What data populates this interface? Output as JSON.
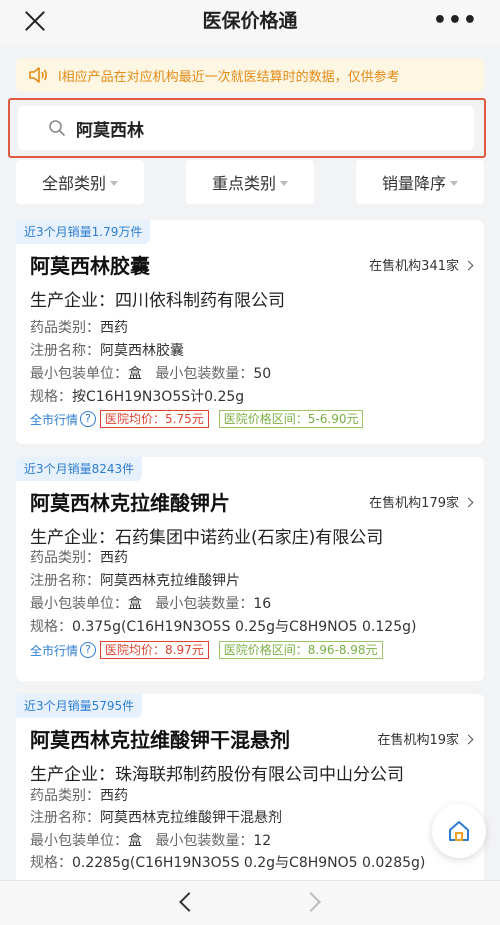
{
  "header": {
    "title": "医保价格通",
    "more": "•••"
  },
  "notice": {
    "text": "l相应产品在对应机构最近一次就医结算时的数据，仅供参考"
  },
  "search": {
    "value": "阿莫西林"
  },
  "filters": [
    {
      "label": "全部类别"
    },
    {
      "label": "重点类别"
    },
    {
      "label": "销量降序"
    }
  ],
  "labels": {
    "maker": "生产企业：",
    "category": "药品类别：",
    "reg_name": "注册名称：",
    "min_unit": "最小包装单位：",
    "min_qty": "最小包装数量：",
    "spec": "规格：",
    "market": "全市行情",
    "help": "?",
    "avg": "医院均价：",
    "range": "医院价格区间："
  },
  "products": [
    {
      "sales": "近3个月销量1.79万件",
      "name": "阿莫西林胶囊",
      "institutions": "在售机构341家",
      "maker": "四川依科制药有限公司",
      "category": "西药",
      "reg_name": "阿莫西林胶囊",
      "min_unit": "盒",
      "min_qty": "50",
      "spec": "按C16H19N3O5S计0.25g",
      "avg_price": "5.75元",
      "price_range": "5-6.90元"
    },
    {
      "sales": "近3个月销量8243件",
      "name": "阿莫西林克拉维酸钾片",
      "institutions": "在售机构179家",
      "maker": "石药集团中诺药业(石家庄)有限公司",
      "category": "西药",
      "reg_name": "阿莫西林克拉维酸钾片",
      "min_unit": "盒",
      "min_qty": "16",
      "spec": "0.375g(C16H19N3O5S 0.25g与C8H9NO5 0.125g)",
      "avg_price": "8.97元",
      "price_range": "8.96-8.98元"
    },
    {
      "sales": "近3个月销量5795件",
      "name": "阿莫西林克拉维酸钾干混悬剂",
      "institutions": "在售机构19家",
      "maker": "珠海联邦制药股份有限公司中山分公司",
      "category": "西药",
      "reg_name": "阿莫西林克拉维酸钾干混悬剂",
      "min_unit": "盒",
      "min_qty": "12",
      "spec": "0.2285g(C16H19N3O5S 0.2g与C8H9NO5 0.0285g)"
    }
  ]
}
